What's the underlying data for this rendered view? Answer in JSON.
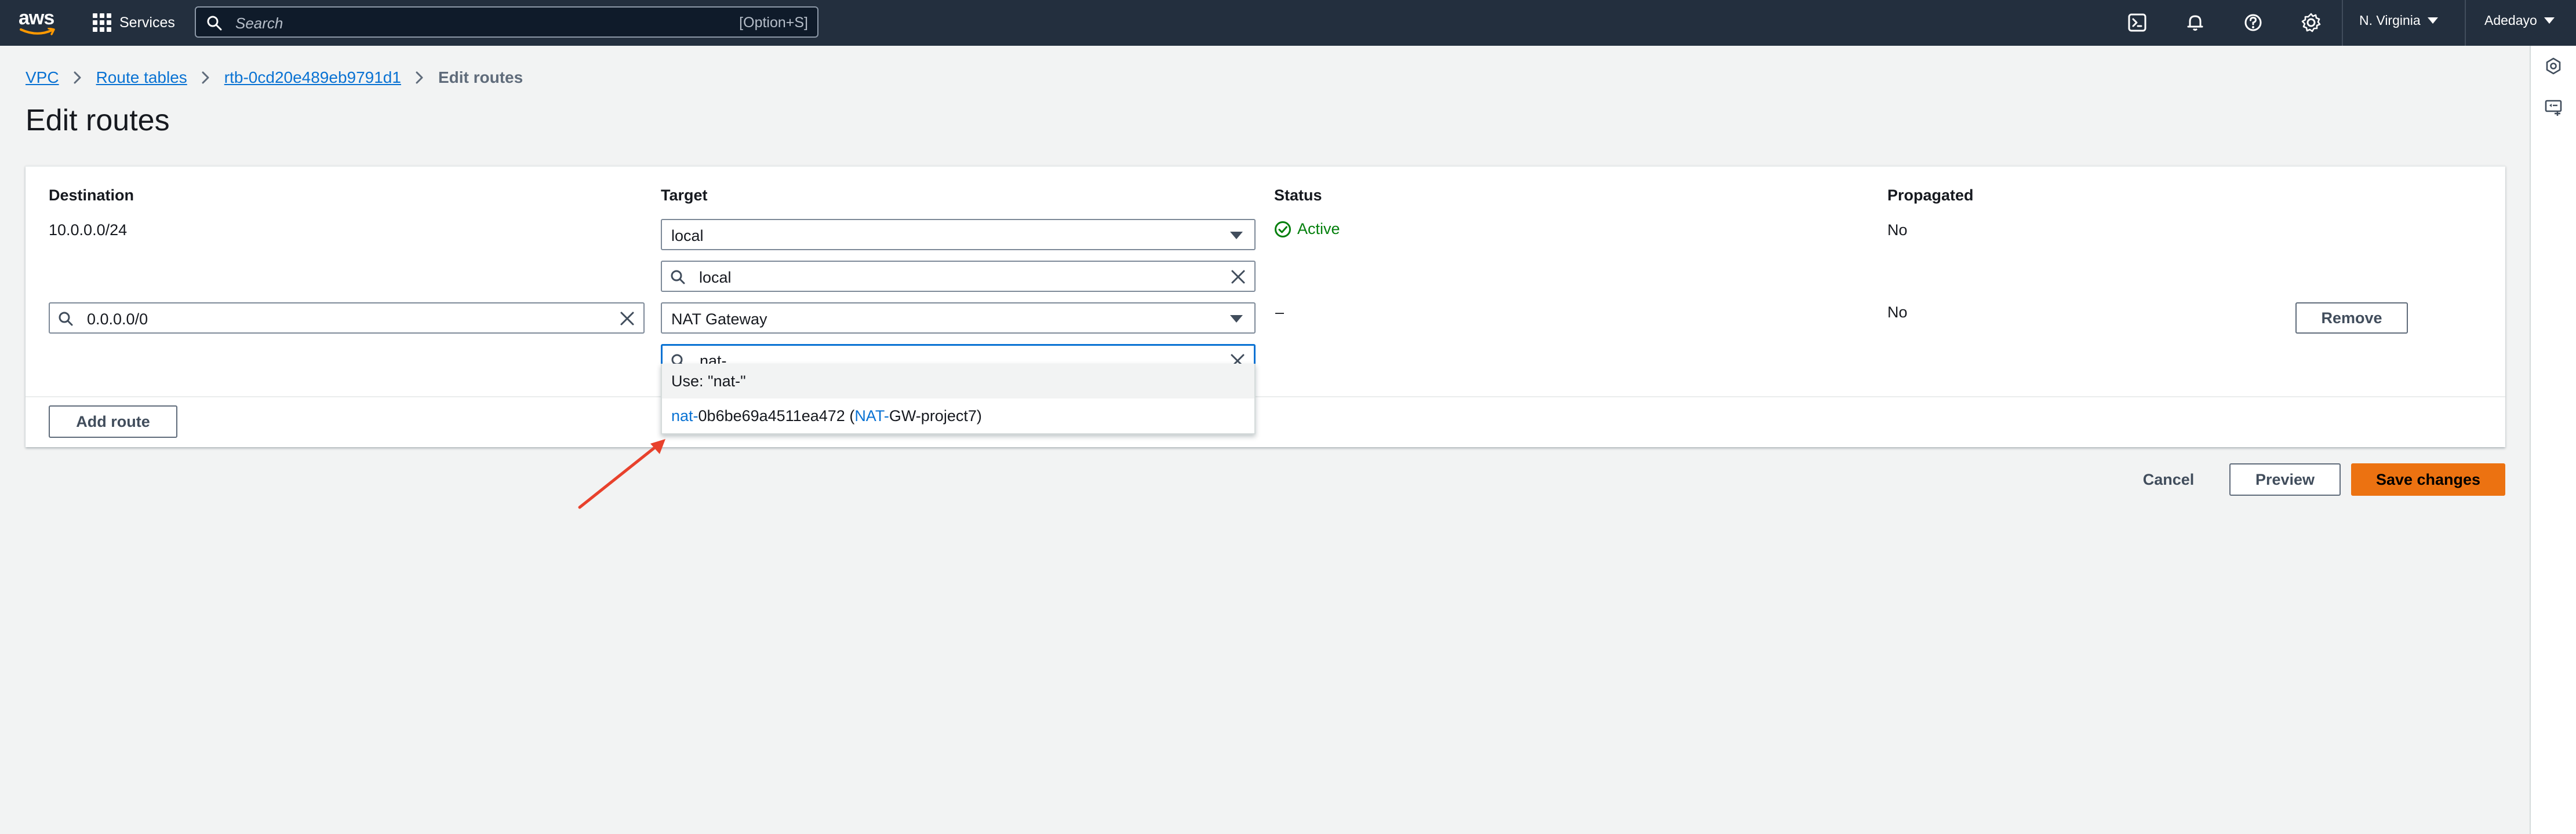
{
  "topnav": {
    "logo_text": "aws",
    "services_label": "Services",
    "search_placeholder": "Search",
    "search_shortcut": "[Option+S]",
    "icons": [
      "cloudshell-icon",
      "bell-icon",
      "help-icon",
      "gear-icon"
    ],
    "region": "N. Virginia",
    "user": "Adedayo"
  },
  "breadcrumb": {
    "items": [
      "VPC",
      "Route tables",
      "rtb-0cd20e489eb9791d1"
    ],
    "current": "Edit routes"
  },
  "page_title": "Edit routes",
  "table": {
    "headers": {
      "destination": "Destination",
      "target": "Target",
      "status": "Status",
      "propagated": "Propagated"
    },
    "rows": [
      {
        "destination": "10.0.0.0/24",
        "target": "local",
        "target_filter": "local",
        "status": "Active",
        "propagated": "No"
      },
      {
        "destination": "0.0.0.0/0",
        "target": "NAT Gateway",
        "target_filter": "nat-",
        "status": "–",
        "propagated": "No",
        "remove_label": "Remove"
      }
    ],
    "dropdown": {
      "use_option": "Use: \"nat-\"",
      "option_prefix": "nat-",
      "option_id_rest": "0b6be69a4511ea472",
      "option_paren_open": " (",
      "option_name_prefix": "NAT-",
      "option_name_rest": "GW-project7)"
    },
    "add_route_label": "Add route"
  },
  "footer": {
    "cancel_label": "Cancel",
    "preview_label": "Preview",
    "save_label": "Save changes"
  },
  "colors": {
    "nav_bg": "#232f3e",
    "link": "#0972d3",
    "active_green": "#037f0c",
    "primary_orange": "#ec7211",
    "annotation_arrow": "#e8412c"
  }
}
